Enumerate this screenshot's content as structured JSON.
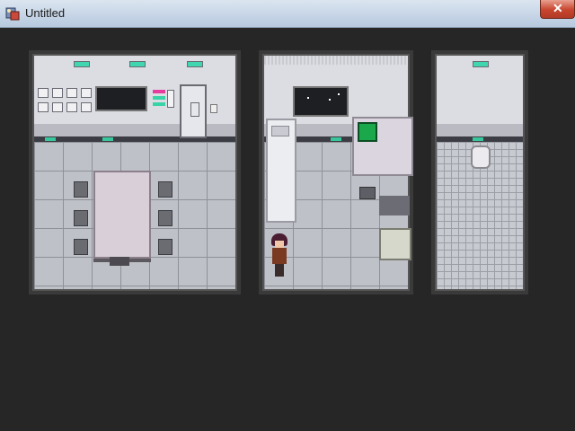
{
  "window": {
    "title": "Untitled",
    "close_glyph": "✕",
    "icon": "app-icon"
  },
  "scene": {
    "rooms": [
      {
        "name": "dining-room",
        "furniture": [
          "wall-console",
          "wall-screen",
          "door",
          "dining-table",
          "chairs"
        ]
      },
      {
        "name": "bedroom",
        "furniture": [
          "wall-window",
          "bed",
          "desk",
          "computer-monitor",
          "cabinet",
          "character"
        ]
      },
      {
        "name": "bathroom",
        "furniture": [
          "toilet"
        ]
      }
    ],
    "colors": {
      "background": "#262626",
      "accent_light": "#3fd6b0",
      "monitor": "#1aa84a"
    }
  }
}
